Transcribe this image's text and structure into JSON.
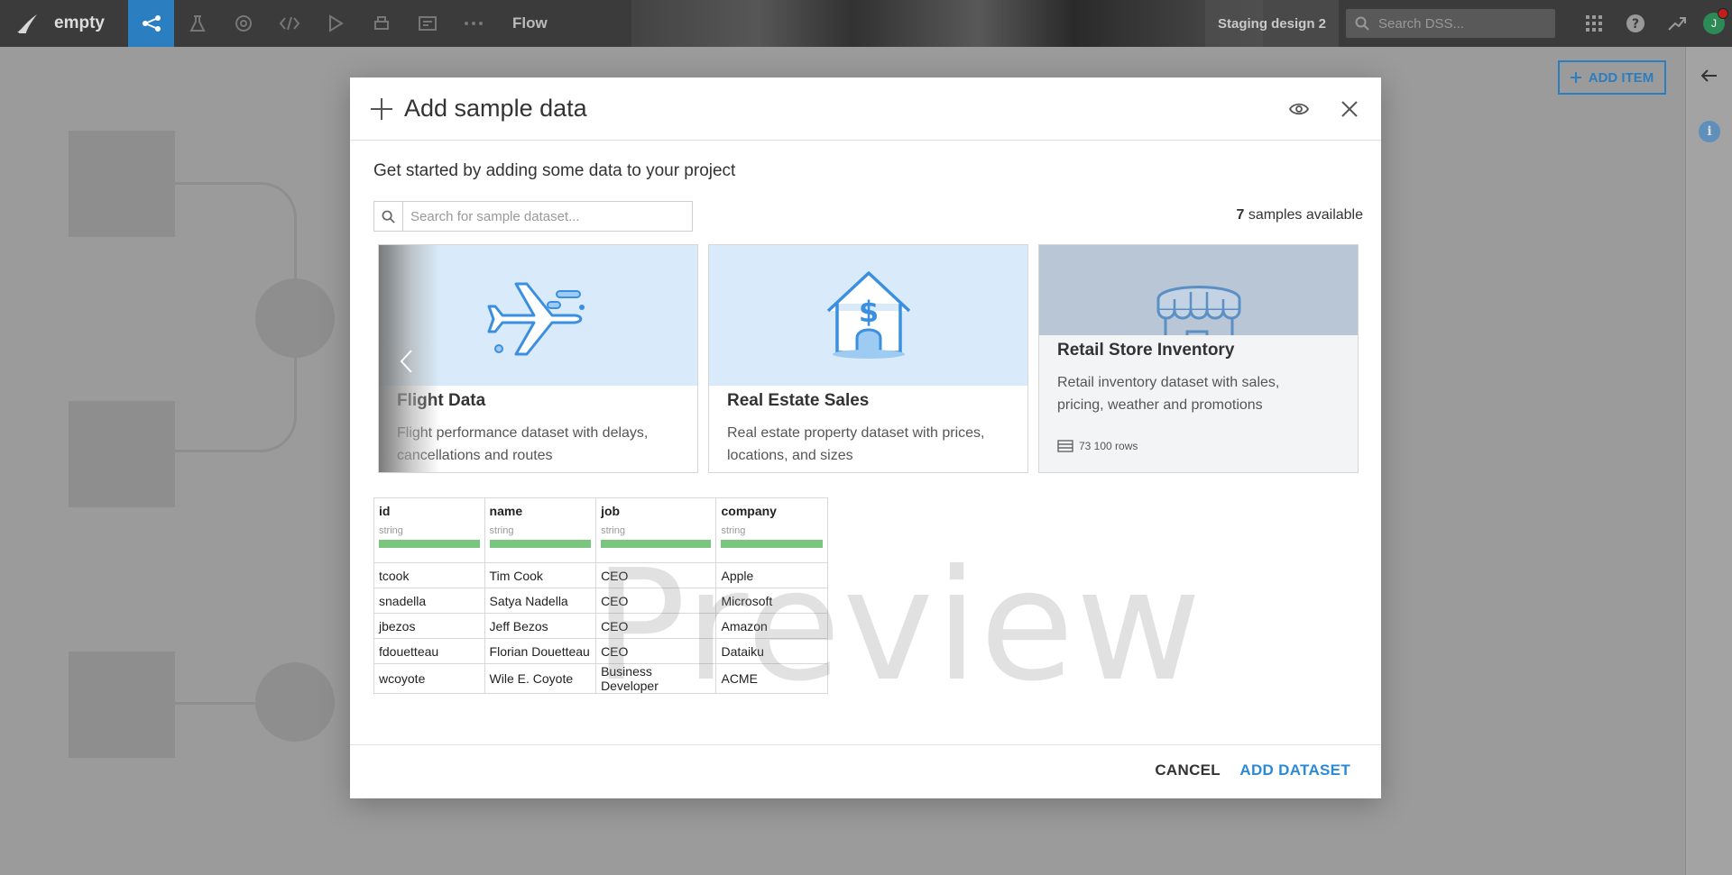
{
  "topbar": {
    "project_name": "empty",
    "current_view": "Flow",
    "instance_name": "Staging design 2",
    "search_placeholder": "Search DSS...",
    "avatar_initial": "J",
    "nav_icons": [
      "flow-icon",
      "lab-icon",
      "recipes-icon",
      "code-icon",
      "run-icon",
      "print-icon",
      "dashboard-icon",
      "more-icon"
    ]
  },
  "flow_page": {
    "add_item_label": "ADD ITEM"
  },
  "modal": {
    "title": "Add sample data",
    "intro": "Get started by adding some data to your project",
    "search_placeholder": "Search for sample dataset...",
    "samples_count": "7",
    "samples_suffix": "samples available",
    "cards": [
      {
        "title": "Flight Data",
        "description": "Flight performance dataset with delays, cancellations and routes",
        "icon": "airplane-icon"
      },
      {
        "title": "Real Estate Sales",
        "description": "Real estate property dataset with prices, locations, and sizes",
        "icon": "house-dollar-icon"
      },
      {
        "title": "Retail Store Inventory",
        "description": "Retail inventory dataset with sales, pricing, weather and promotions",
        "icon": "storefront-icon",
        "rows": "73 100 rows"
      }
    ],
    "preview": {
      "watermark": "Preview",
      "columns": [
        {
          "name": "id",
          "type": "string"
        },
        {
          "name": "name",
          "type": "string"
        },
        {
          "name": "job",
          "type": "string"
        },
        {
          "name": "company",
          "type": "string"
        }
      ],
      "rows": [
        [
          "tcook",
          "Tim Cook",
          "CEO",
          "Apple"
        ],
        [
          "snadella",
          "Satya Nadella",
          "CEO",
          "Microsoft"
        ],
        [
          "jbezos",
          "Jeff Bezos",
          "CEO",
          "Amazon"
        ],
        [
          "fdouetteau",
          "Florian Douetteau",
          "CEO",
          "Dataiku"
        ],
        [
          "wcoyote",
          "Wile E. Coyote",
          "Business Developer",
          "ACME"
        ]
      ]
    },
    "footer": {
      "cancel_label": "CANCEL",
      "add_label": "ADD DATASET"
    }
  },
  "colors": {
    "accent": "#2b7ec0",
    "card_hero": "#d9ebfa",
    "quality_bar": "#7ac67e"
  }
}
